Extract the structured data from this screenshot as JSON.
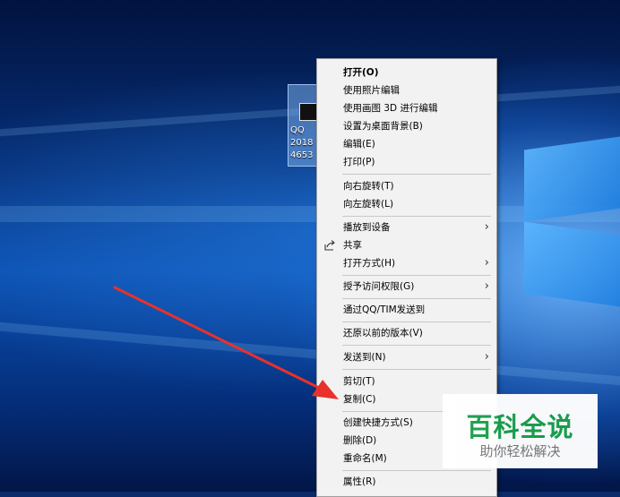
{
  "desktop_icon": {
    "label": "QQ\n2018\n4653",
    "thumbnail_icon": "image-file-icon"
  },
  "context_menu": {
    "items": [
      {
        "label": "打开(O)",
        "bold": true
      },
      {
        "label": "使用照片编辑"
      },
      {
        "label": "使用画图 3D 进行编辑"
      },
      {
        "label": "设置为桌面背景(B)"
      },
      {
        "label": "编辑(E)"
      },
      {
        "label": "打印(P)"
      },
      {
        "label": "向右旋转(T)"
      },
      {
        "label": "向左旋转(L)"
      },
      {
        "label": "播放到设备",
        "submenu": true
      },
      {
        "label": "共享",
        "icon": "share-icon"
      },
      {
        "label": "打开方式(H)",
        "submenu": true
      },
      {
        "label": "授予访问权限(G)",
        "submenu": true
      },
      {
        "label": "通过QQ/TIM发送到"
      },
      {
        "label": "还原以前的版本(V)"
      },
      {
        "label": "发送到(N)",
        "submenu": true
      },
      {
        "label": "剪切(T)"
      },
      {
        "label": "复制(C)"
      },
      {
        "label": "创建快捷方式(S)"
      },
      {
        "label": "删除(D)"
      },
      {
        "label": "重命名(M)"
      },
      {
        "label": "属性(R)"
      }
    ],
    "submenu_glyph": "›"
  },
  "annotation": {
    "arrow_color": "#e8322a",
    "points_to": "复制(C)"
  },
  "watermark": {
    "title": "百科全说",
    "subtitle": "助你轻松解决",
    "title_color": "#1aa04a"
  }
}
